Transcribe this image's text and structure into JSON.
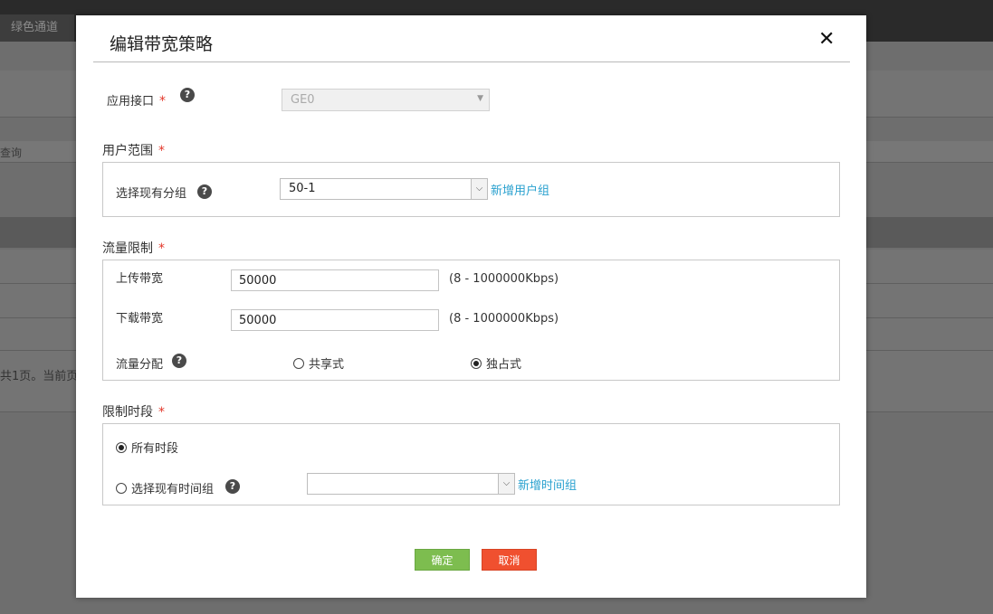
{
  "background": {
    "tab_label": "绿色通道",
    "partial_text_1": "查询",
    "partial_text_2": "共1页。当前页"
  },
  "modal": {
    "title": "编辑带宽策略",
    "close_symbol": "✕",
    "interface": {
      "label": "应用接口",
      "required_mark": "*",
      "help": "?",
      "value": "GE0",
      "arrow": "▼"
    },
    "user_scope": {
      "label": "用户范围",
      "required_mark": "*",
      "select_label": "选择现有分组",
      "help": "?",
      "value": "50-1",
      "arrow": "⌵",
      "add_link": "新增用户组"
    },
    "traffic_limit": {
      "label": "流量限制",
      "required_mark": "*",
      "upload_label": "上传带宽",
      "upload_value": "50000",
      "upload_range": "(8 - 1000000Kbps)",
      "download_label": "下载带宽",
      "download_value": "50000",
      "download_range": "(8 - 1000000Kbps)",
      "distribution_label": "流量分配",
      "help": "?",
      "option_shared": "共享式",
      "option_exclusive": "独占式",
      "selected": "exclusive"
    },
    "time_limit": {
      "label": "限制时段",
      "required_mark": "*",
      "option_all": "所有时段",
      "option_select": "选择现有时间组",
      "help": "?",
      "value": "",
      "arrow": "⌵",
      "add_link": "新增时间组",
      "selected": "all"
    },
    "buttons": {
      "ok": "确定",
      "cancel": "取消"
    }
  }
}
